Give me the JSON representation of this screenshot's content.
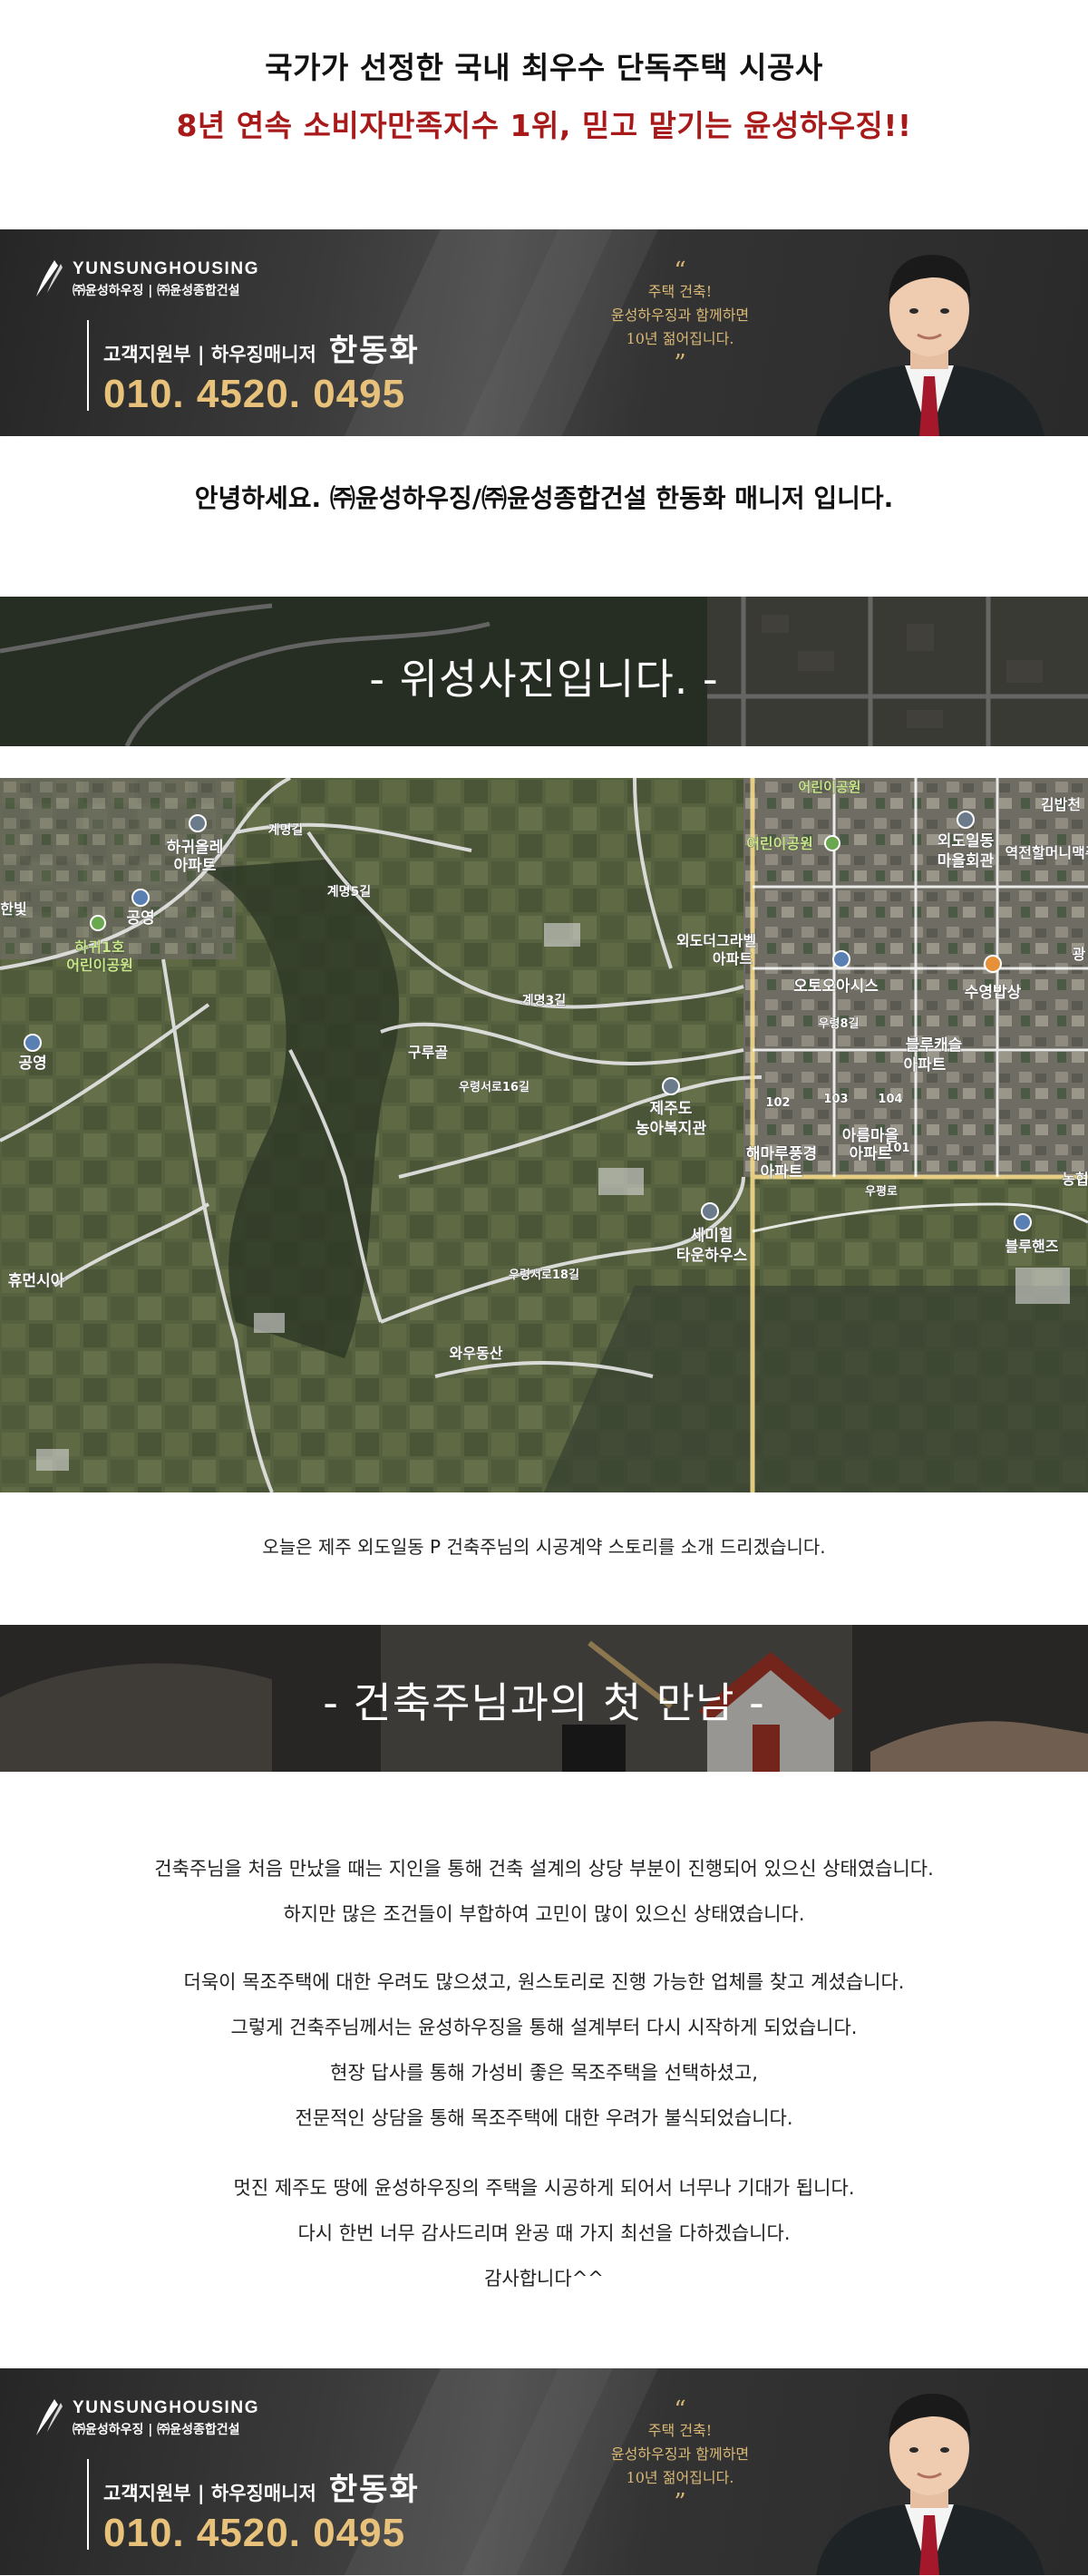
{
  "intro": {
    "line1": "국가가 선정한 국내 최우수 단독주택 시공사",
    "line2": "8년 연속 소비자만족지수 1위, 믿고 맡기는 윤성하우징!!"
  },
  "banner": {
    "logo_en": "YUNSUNGHOUSING",
    "logo_ko": "㈜윤성하우징 | ㈜윤성종합건설",
    "role": "고객지원부 | 하우징매니저",
    "name": "한동화",
    "phone": "010. 4520. 0495",
    "quote_open": "“",
    "quote_lines": [
      "주택 건축!",
      "윤성하우징과 함께하면",
      "10년 젊어집니다."
    ],
    "quote_close": "”"
  },
  "greeting": "안녕하세요. ㈜윤성하우징/㈜윤성종합건설 한동화 매니저 입니다.",
  "satellite": {
    "title": "- 위성사진입니다. -",
    "labels": {
      "hakwi_apt": "하귀올레\n아파트",
      "hakwi_apt_l1": "하귀올레",
      "hakwi_apt_l2": "아파트",
      "gyemyeong": "계명길",
      "gyemyeong5": "계명5길",
      "gyemyeong3": "계명3길",
      "hanbit": "한빛",
      "gongyeong": "공영",
      "gongyeong2": "공영",
      "hakwi1_l1": "하귀1호",
      "hakwi1_l2": "어린이공원",
      "gururgol": "구루골",
      "woosangro16": "우령서로16길",
      "woosangro18": "우령서로18길",
      "jeju_agri_l1": "제주도",
      "jeju_agri_l2": "농아복지관",
      "seminal_l1": "세미힐",
      "seminal_l2": "타운하우스",
      "wawoo": "와우동산",
      "huemyeon": "휴먼시아",
      "children_park": "어린이공원",
      "children_park2": "어린이공원",
      "woedo_grabel_l1": "외도더그라벨",
      "woedo_grabel_l2": "아파트",
      "otoasis": "오토오아시스",
      "suyeong": "수영밥상",
      "woedoildong_l1": "외도일동",
      "woedoildong_l2": "마을회관",
      "yeokjeon": "역전할머니맥주",
      "kimbap": "김밥천",
      "gwang": "광",
      "bluecastle_l1": "블루캐슬",
      "bluecastle_l2": "아파트",
      "haemaru_l1": "해마루풍경",
      "haemaru_l2": "아파트",
      "areum_l1": "아름마을",
      "areum_l2": "아파트",
      "bluehands": "블루핸즈",
      "woopyeongro": "우평로",
      "woryeong8": "우령8길",
      "n102": "102",
      "n103": "103",
      "n104": "104",
      "n101": "101",
      "nonghyup": "농협"
    }
  },
  "caption": "오늘은 제주 외도일동 P 건축주님의 시공계약 스토리를 소개 드리겠습니다.",
  "meet": {
    "title": "- 건축주님과의 첫 만남 -"
  },
  "story": {
    "p1": [
      "건축주님을 처음 만났을 때는 지인을 통해 건축 설계의 상당 부분이 진행되어 있으신 상태였습니다.",
      "하지만 많은 조건들이 부합하여 고민이 많이 있으신 상태였습니다."
    ],
    "p2": [
      "더욱이 목조주택에 대한 우려도 많으셨고, 원스토리로 진행 가능한 업체를 찾고 계셨습니다.",
      "그렇게 건축주님께서는 윤성하우징을 통해 설계부터 다시 시작하게 되었습니다.",
      "현장 답사를 통해 가성비 좋은 목조주택을 선택하셨고,",
      "전문적인 상담을 통해 목조주택에 대한 우려가 불식되었습니다."
    ],
    "p3": [
      "멋진 제주도 땅에 윤성하우징의 주택을 시공하게 되어서 너무나 기대가 됩니다.",
      "다시 한번 너무 감사드리며 완공 때 가지 최선을 다하겠습니다.",
      "감사합니다^^"
    ]
  }
}
